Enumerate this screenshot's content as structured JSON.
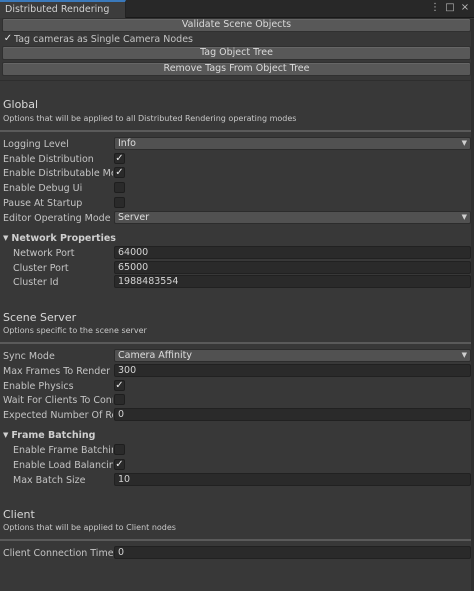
{
  "window": {
    "tab_title": "Distributed Rendering",
    "icons": [
      "more-options-icon",
      "maximize-icon",
      "close-icon"
    ],
    "icon_glyphs": [
      "⋮",
      "□",
      "×"
    ]
  },
  "toolbar": {
    "validate_label": "Validate Scene Objects",
    "tag_cameras_checked": true,
    "tag_cameras_label": "Tag cameras as Single Camera Nodes",
    "tag_tree_label": "Tag Object Tree",
    "remove_tags_label": "Remove Tags From Object Tree"
  },
  "global": {
    "title": "Global",
    "description": "Options that will be applied to all Distributed Rendering operating modes",
    "logging_level": {
      "label": "Logging Level",
      "value": "Info"
    },
    "enable_distribution": {
      "label": "Enable Distribution",
      "checked": true
    },
    "enable_distributable_methods": {
      "label": "Enable Distributable Methods",
      "checked": true
    },
    "enable_debug_ui": {
      "label": "Enable Debug Ui",
      "checked": false
    },
    "pause_at_startup": {
      "label": "Pause At Startup",
      "checked": false
    },
    "editor_operating_mode": {
      "label": "Editor Operating Mode",
      "value": "Server"
    },
    "network_properties": {
      "title": "Network Properties",
      "network_port": {
        "label": "Network Port",
        "value": "64000"
      },
      "cluster_port": {
        "label": "Cluster Port",
        "value": "65000"
      },
      "cluster_id": {
        "label": "Cluster Id",
        "value": "1988483554"
      }
    }
  },
  "scene_server": {
    "title": "Scene Server",
    "description": "Options specific to the scene server",
    "sync_mode": {
      "label": "Sync Mode",
      "value": "Camera Affinity"
    },
    "max_frames_to_render": {
      "label": "Max Frames To Render",
      "value": "300"
    },
    "enable_physics": {
      "label": "Enable Physics",
      "checked": true
    },
    "wait_for_clients": {
      "label": "Wait For Clients To Connect",
      "checked": false
    },
    "expected_number_of_render_nodes": {
      "label": "Expected Number Of Render Nodes",
      "value": "0"
    },
    "frame_batching": {
      "title": "Frame Batching",
      "enable_frame_batching": {
        "label": "Enable Frame Batching",
        "checked": false
      },
      "enable_load_balancing": {
        "label": "Enable Load Balancing",
        "checked": true
      },
      "max_batch_size": {
        "label": "Max Batch Size",
        "value": "10"
      }
    }
  },
  "client": {
    "title": "Client",
    "description": "Options that will be applied to Client nodes",
    "client_connection_timeout": {
      "label": "Client Connection Timeout",
      "value": "0"
    }
  }
}
